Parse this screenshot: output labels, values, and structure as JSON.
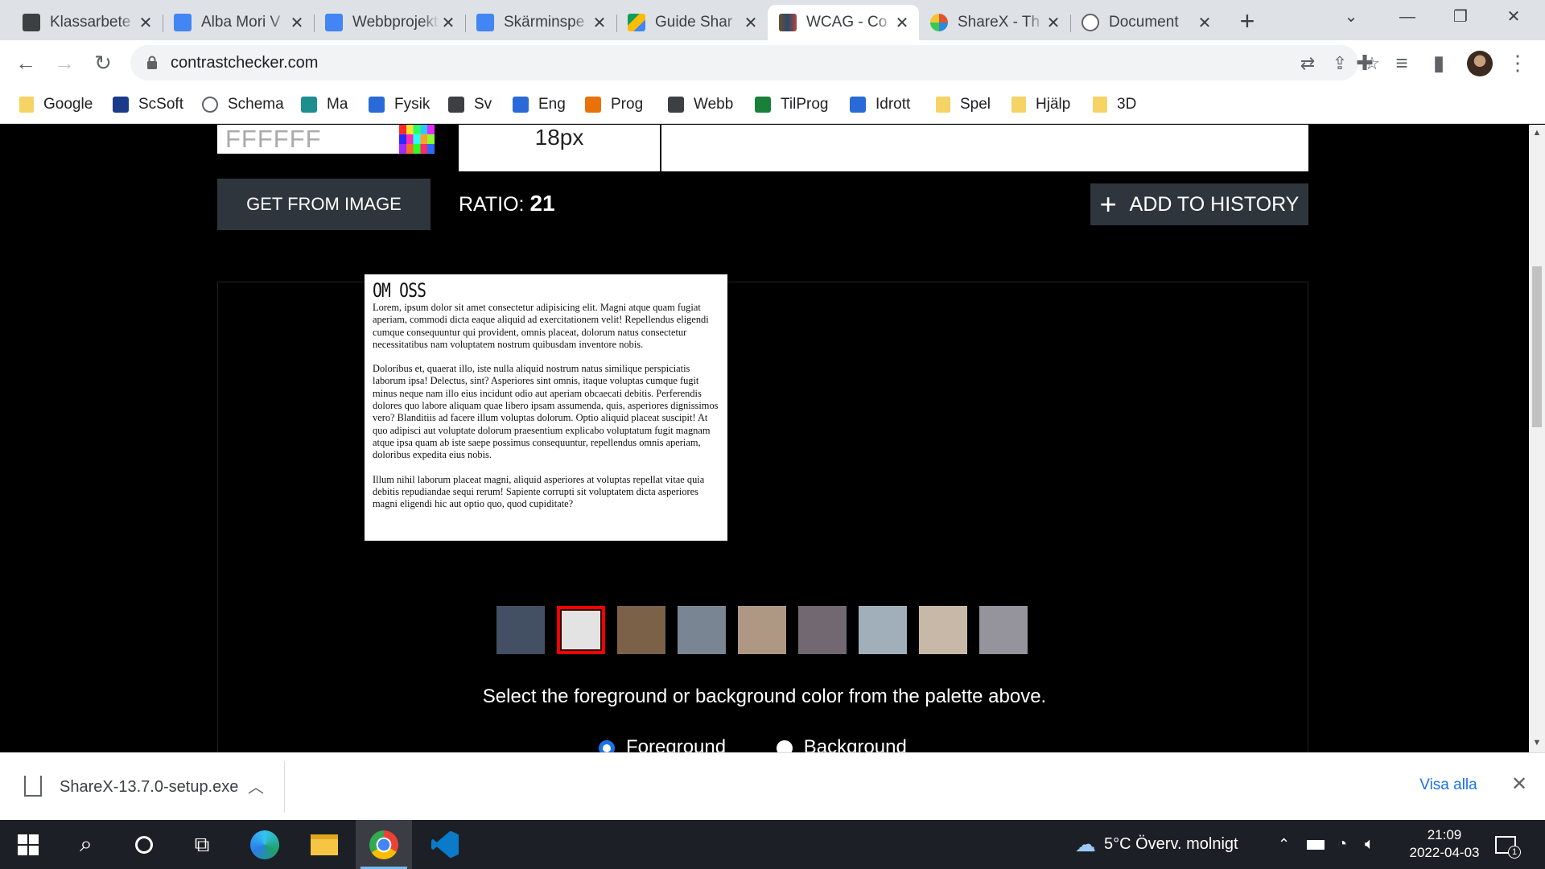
{
  "browser": {
    "tabs": [
      {
        "title": "Klassarbete",
        "favicon_color": "#3c4043",
        "active": false
      },
      {
        "title": "Alba Mori V",
        "favicon_color": "#4285f4",
        "active": false
      },
      {
        "title": "Webbprojekt",
        "favicon_color": "#4285f4",
        "active": false
      },
      {
        "title": "Skärminspe",
        "favicon_color": "#4285f4",
        "active": false
      },
      {
        "title": "Guide Shar",
        "favicon_color": "#0f9d58",
        "active": false
      },
      {
        "title": "WCAG - Co",
        "favicon_color": "#6b4f2a",
        "active": true
      },
      {
        "title": "ShareX - Th",
        "favicon_color": "#e2542b",
        "active": false
      },
      {
        "title": "Document",
        "favicon_color": "#5f6368",
        "active": false
      }
    ],
    "new_tab_label": "+",
    "url": "contrastchecker.com",
    "bookmarks": [
      {
        "label": "Google",
        "icon": "folder"
      },
      {
        "label": "ScSoft",
        "icon": "app-icon"
      },
      {
        "label": "Schema",
        "icon": "globe-icon"
      },
      {
        "label": "Ma",
        "icon": "classroom-icon"
      },
      {
        "label": "Fysik",
        "icon": "classroom-icon"
      },
      {
        "label": "Sv",
        "icon": "classroom-icon"
      },
      {
        "label": "Eng",
        "icon": "classroom-icon"
      },
      {
        "label": "Prog",
        "icon": "classroom-icon"
      },
      {
        "label": "Webb",
        "icon": "classroom-icon"
      },
      {
        "label": "TilProg",
        "icon": "classroom-icon"
      },
      {
        "label": "Idrott",
        "icon": "classroom-icon"
      },
      {
        "label": "Spel",
        "icon": "folder"
      },
      {
        "label": "Hjälp",
        "icon": "folder"
      },
      {
        "label": "3D",
        "icon": "folder"
      }
    ]
  },
  "page": {
    "hex_value": "FFFFFF",
    "font_size": "18px",
    "get_from_image_label": "GET FROM IMAGE",
    "ratio_label": "RATIO:",
    "ratio_value": "21",
    "add_history_label": "ADD TO HISTORY",
    "preview": {
      "heading": "OM OSS",
      "paragraphs": [
        "Lorem, ipsum dolor sit amet consectetur adipisicing elit. Magni atque quam fugiat aperiam, commodi dicta eaque aliquid ad exercitationem velit! Repellendus eligendi cumque consequuntur qui provident, omnis placeat, dolorum natus consectetur necessitatibus nam voluptatem nostrum quibusdam inventore nobis.",
        "Doloribus et, quaerat illo, iste nulla aliquid nostrum natus similique perspiciatis laborum ipsa! Delectus, sint? Asperiores sint omnis, itaque voluptas cumque fugit minus neque nam illo eius incidunt odio aut aperiam obcaecati debitis. Perferendis dolores quo labore aliquam quae libero ipsam assumenda, quis, asperiores dignissimos vero? Blanditiis ad facere illum voluptas dolorum. Optio aliquid placeat suscipit! At quo adipisci aut voluptate dolorum praesentium explicabo voluptatum fugit magnam atque ipsa quam ab iste saepe possimus consequuntur, repellendus omnis aperiam, doloribus expedita eius nobis.",
        "Illum nihil laborum placeat magni, aliquid asperiores at voluptas repellat vitae quia debitis repudiandae sequi rerum! Sapiente corrupti sit voluptatem dicta asperiores magni eligendi hic aut optio quo, quod cupiditate?"
      ]
    },
    "palette": [
      "#434f63",
      "#e3e3e3",
      "#7a6148",
      "#7a8593",
      "#ae9884",
      "#716872",
      "#a1afbb",
      "#c7b8a7",
      "#95949c"
    ],
    "palette_selected": 1,
    "hint": "Select the foreground or background color from the palette above.",
    "radio_foreground": "Foreground",
    "radio_background": "Background"
  },
  "downloads": {
    "filename": "ShareX-13.7.0-setup.exe",
    "show_all": "Visa alla"
  },
  "taskbar": {
    "weather": "5°C  Överv. molnigt",
    "time": "21:09",
    "date": "2022-04-03",
    "notifications": "1"
  }
}
